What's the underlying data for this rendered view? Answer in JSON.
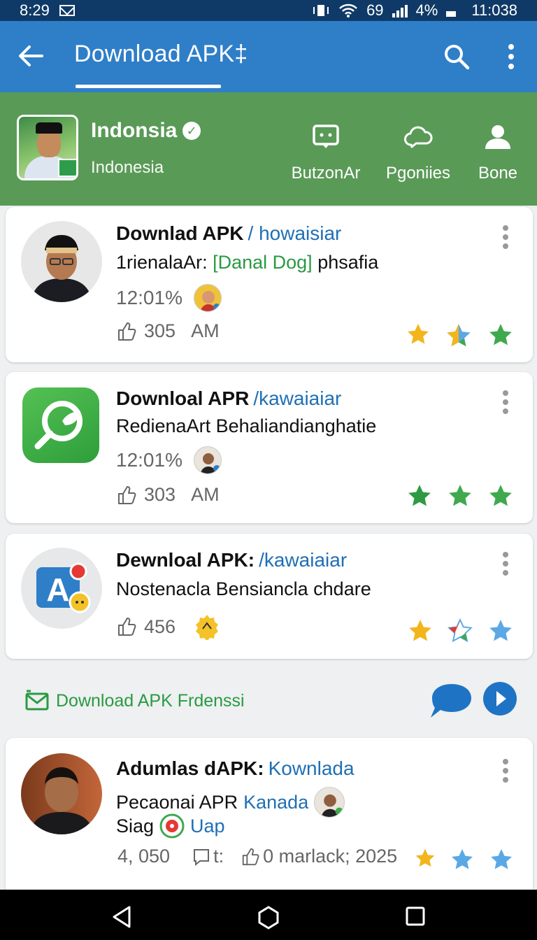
{
  "status_bar": {
    "time": "8:29",
    "net": "69",
    "battery": "4%",
    "clock": "11:038"
  },
  "app_bar": {
    "title": "Download APK‡"
  },
  "profile": {
    "name": "Indonsia",
    "subtitle": "Indonesia",
    "actions": [
      {
        "label": "ButzonAr",
        "icon": "chat-bubble-icon"
      },
      {
        "label": "Pgoniies",
        "icon": "cloud-chat-icon"
      },
      {
        "label": "Bone",
        "icon": "person-icon"
      }
    ]
  },
  "cards": [
    {
      "title": "Downlad APK",
      "tag": "/ howaisiar",
      "line2_a": "1rienalaAr:",
      "line2_hl": "[Danal Dog]",
      "line2_b": "phsafia",
      "pct": "12:01%",
      "likes": "305",
      "likes_suffix": "AM",
      "stars": [
        "#f2b51c",
        "mixed",
        "#3fa94e"
      ]
    },
    {
      "title": "Downloal APR",
      "tag": "/kawaiaiar",
      "line2": "RedienaArt  Behaliandianghatie",
      "pct": "12:01%",
      "likes": "303",
      "likes_suffix": "AM",
      "stars": [
        "#2f9a44",
        "#3fa94e",
        "#3fa94e"
      ]
    },
    {
      "title": "Dewnloal APK:",
      "tag": "/kawaiaiar",
      "line2": "Nostenacla  Bensiancla chdare",
      "likes": "456",
      "stars": [
        "#f2b51c",
        "mixed",
        "#5aa9e6"
      ]
    }
  ],
  "promo": {
    "label": "Download APK Frdenssi"
  },
  "card4": {
    "title": "Adumlas dAPK:",
    "tag": "Kownlada",
    "line2_a": "Pecaonai APR",
    "line2_b": "Kanada",
    "line3_a": "Siag",
    "line3_b": "Uap",
    "count": "4,  050",
    "chat": "t:",
    "likes": "0 marlack; 2025",
    "stars": [
      "#f2b51c",
      "#5aa9e6",
      "#5aa9e6"
    ]
  }
}
